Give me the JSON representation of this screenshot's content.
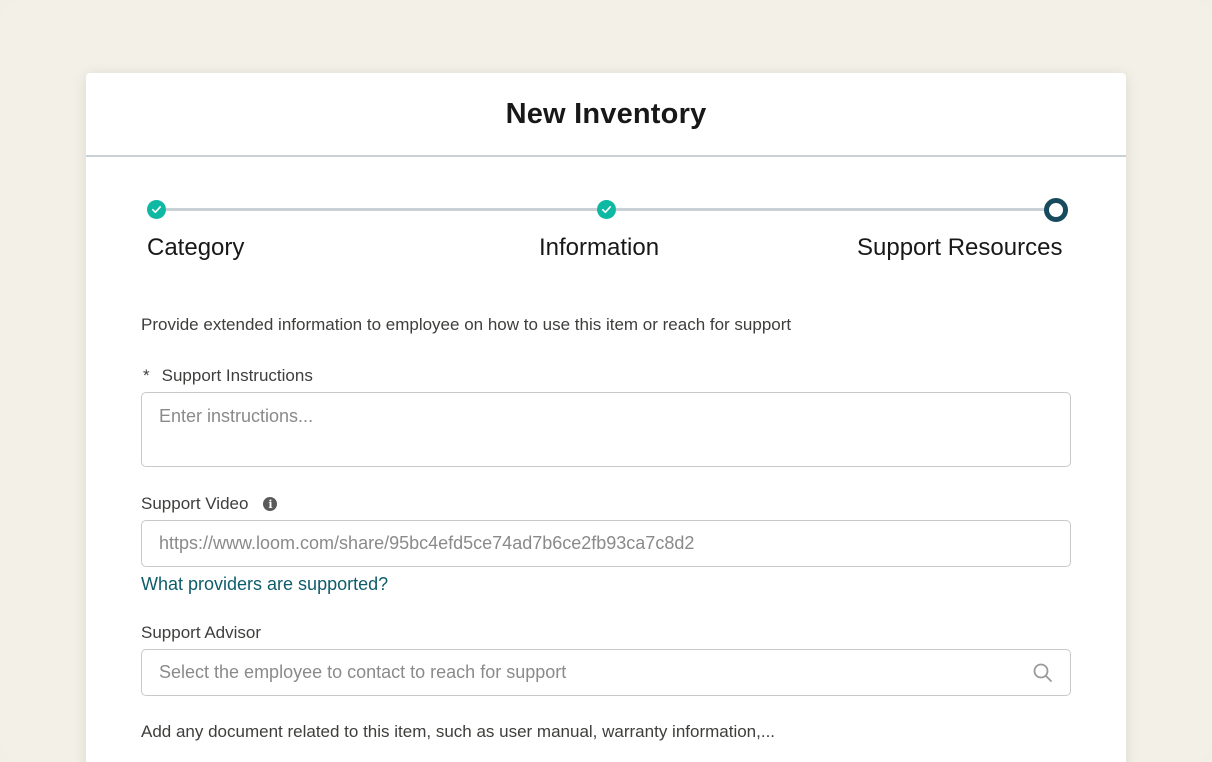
{
  "modal": {
    "title": "New Inventory"
  },
  "steps": [
    {
      "label": "Category",
      "state": "complete"
    },
    {
      "label": "Information",
      "state": "complete"
    },
    {
      "label": "Support Resources",
      "state": "current"
    }
  ],
  "form": {
    "intro": "Provide extended information to employee on how to use this item or reach for support",
    "instructions": {
      "required_marker": "*",
      "label": "Support Instructions",
      "placeholder": "Enter instructions..."
    },
    "video": {
      "label": "Support Video",
      "info_icon": "i",
      "placeholder": "https://www.loom.com/share/95bc4efd5ce74ad7b6ce2fb93ca7c8d2",
      "help_link": "What providers are supported?"
    },
    "advisor": {
      "label": "Support Advisor",
      "placeholder": "Select the employee to contact to reach for support",
      "icon": "search-icon"
    },
    "documents": {
      "text": "Add any document related to this item, such as user manual, warranty information,..."
    }
  },
  "colors": {
    "accent": "#0fb8a3",
    "current_step": "#174a5c",
    "link": "#0f5c6b",
    "background": "#f3f0e7"
  }
}
